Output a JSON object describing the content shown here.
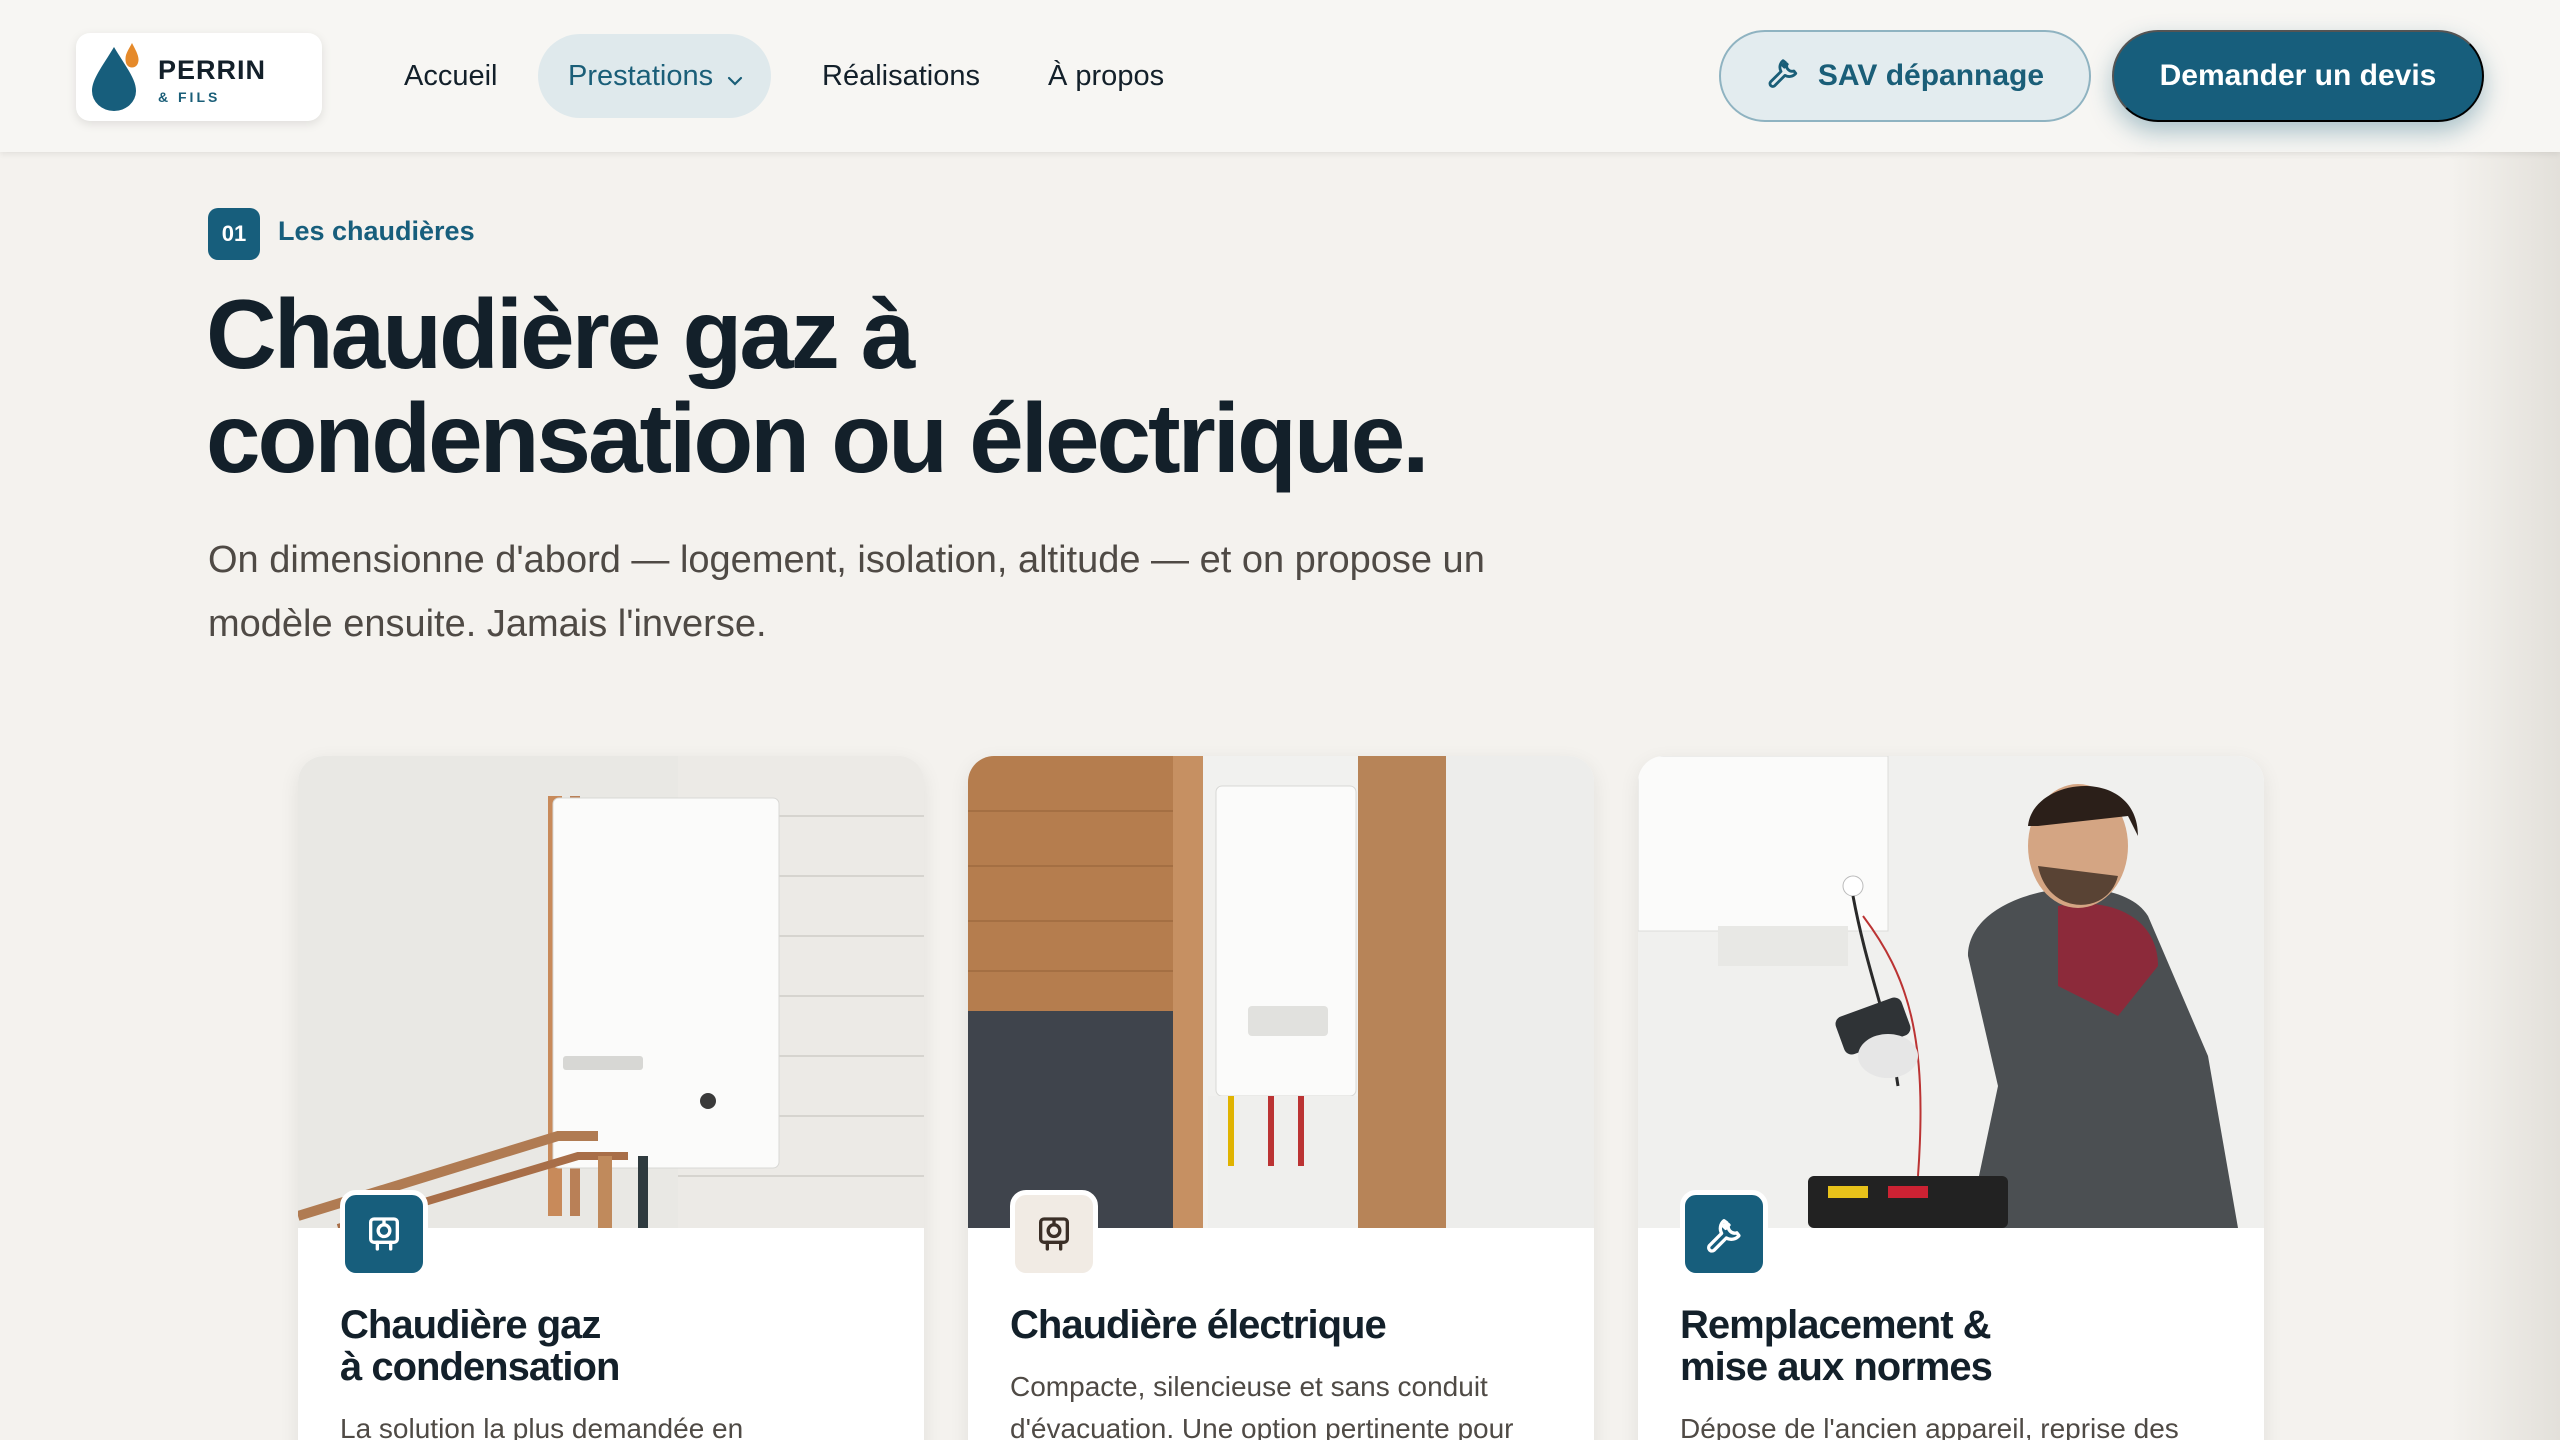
{
  "header": {
    "logo": {
      "name": "PERRIN",
      "sub": "& FILS"
    },
    "nav": [
      {
        "label": "Accueil"
      },
      {
        "label": "Prestations"
      },
      {
        "label": "Réalisations"
      },
      {
        "label": "À propos"
      }
    ],
    "sav_label": "SAV dépannage",
    "devis_label": "Demander un devis"
  },
  "hero": {
    "step_number": "01",
    "step_label": "Les chaudières",
    "title_line1": "Chaudière gaz à",
    "title_line2": "condensation ou électrique.",
    "subtitle_line1": "On dimensionne d'abord — logement, isolation, altitude — et on propose un",
    "subtitle_line2": "modèle ensuite. Jamais l'inverse."
  },
  "cards": [
    {
      "icon": "boiler-icon",
      "title_line1": "Chaudière gaz",
      "title_line2": "à condensation",
      "text": "La solution la plus demandée en"
    },
    {
      "icon": "boiler-icon",
      "title_line1": "Chaudière électrique",
      "title_line2": "",
      "text_line1": "Compacte, silencieuse et sans conduit",
      "text_line2": "d'évacuation. Une option pertinente pour"
    },
    {
      "icon": "wrench-icon",
      "title_line1": "Remplacement &",
      "title_line2": "mise aux normes",
      "text": "Dépose de l'ancien appareil, reprise des"
    }
  ],
  "colors": {
    "brand": "#175e7c",
    "background": "#f4f2ee",
    "text": "#13202a",
    "flame": "#e58a2b"
  }
}
